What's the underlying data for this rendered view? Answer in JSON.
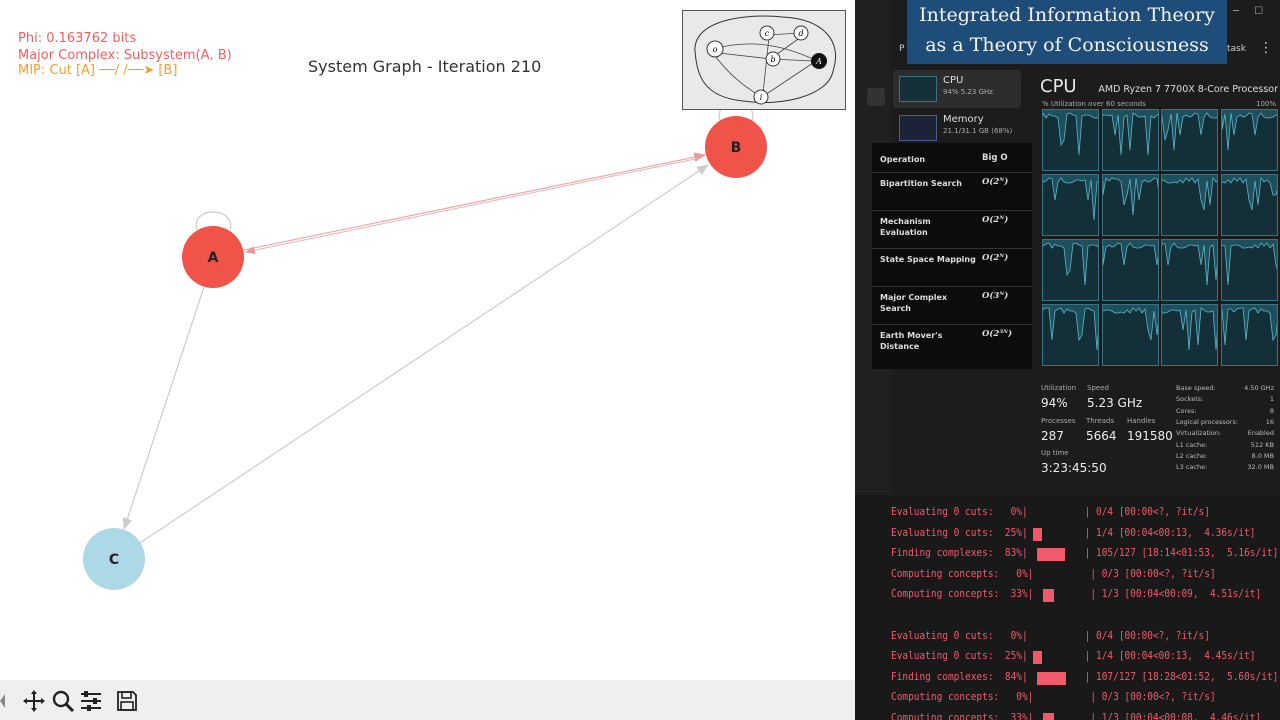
{
  "plot": {
    "phi": "Phi: 0.163762 bits",
    "major_complex": "Major Complex: Subsystem(A, B)",
    "mip": "MIP: Cut [A] ──/ /──➤ [B]",
    "title": "System Graph - Iteration 210",
    "nodes": [
      {
        "label": "A",
        "color": "#f05449"
      },
      {
        "label": "B",
        "color": "#f05449"
      },
      {
        "label": "C",
        "color": "#add8e6"
      }
    ],
    "colors": {
      "phi": "#f06060",
      "major_complex": "#f06060",
      "mip": "#f0a030",
      "edge_ab": "#e8a8a8",
      "edge": "#cccccc"
    }
  },
  "toolbar": {
    "icons": [
      "move-icon",
      "zoom-icon",
      "configure-icon",
      "save-icon"
    ]
  },
  "thumbnail": {
    "nodes": [
      "o",
      "c",
      "d",
      "b",
      "A",
      "i"
    ]
  },
  "banner": {
    "line1": "Integrated Information Theory",
    "line2": "as a Theory of Consciousness"
  },
  "taskmanager": {
    "nav": [
      {
        "label": "CPU",
        "sub": "94% 5.23 GHz"
      },
      {
        "label": "Memory",
        "sub": "21.1/31.1 GB (68%)"
      }
    ],
    "partial": {
      "left": "P",
      "right": "task"
    },
    "cpu_title": "CPU",
    "cpu_model": "AMD Ryzen 7 7700X 8-Core Processor",
    "util_label": "% Utilization over 60 seconds",
    "util_max": "100%",
    "utilization_label": "Utilization",
    "utilization": "94%",
    "speed_label": "Speed",
    "speed": "5.23 GHz",
    "processes_label": "Processes",
    "processes": "287",
    "threads_label": "Threads",
    "threads": "5664",
    "handles_label": "Handles",
    "handles": "191580",
    "uptime_label": "Up time",
    "uptime": "3:23:45:50",
    "specs": [
      {
        "k": "Base speed:",
        "v": "4.50 GHz"
      },
      {
        "k": "Sockets:",
        "v": "1"
      },
      {
        "k": "Cores:",
        "v": "8"
      },
      {
        "k": "Logical processors:",
        "v": "16"
      },
      {
        "k": "Virtualization:",
        "v": "Enabled"
      },
      {
        "k": "L1 cache:",
        "v": "512 KB"
      },
      {
        "k": "L2 cache:",
        "v": "8.0 MB"
      },
      {
        "k": "L3 cache:",
        "v": "32.0 MB"
      }
    ]
  },
  "complexity": {
    "head_op": "Operation",
    "head_cx": "Big O",
    "rows": [
      {
        "op": "Bipartition Search",
        "cx": "O(2ᴺ)"
      },
      {
        "op": "Mechanism Evaluation",
        "cx": "O(2ᴺ)"
      },
      {
        "op": "State Space Mapping",
        "cx": "O(2ᴺ)"
      },
      {
        "op": "Major Complex Search",
        "cx": "O(3ᴺ)"
      },
      {
        "op": "Earth Mover's Distance",
        "cx": "O(2³ᴺ)"
      }
    ]
  },
  "terminal": {
    "lines": [
      {
        "text": "Evaluating 0 cuts:   0%|          | 0/4 [00:00<?, ?it/s]",
        "pct": 0
      },
      {
        "text": "Evaluating 0 cuts:  25%|          | 1/4 [00:04<00:13,  4.36s/it]",
        "pct": 25
      },
      {
        "text": "Finding complexes:  83%|          | 105/127 [18:14<01:53,  5.16s/it]",
        "pct": 83
      },
      {
        "text": "Computing concepts:   0%|          | 0/3 [00:00<?, ?it/s]",
        "pct": 0
      },
      {
        "text": "Computing concepts:  33%|          | 1/3 [00:04<00:09,  4.51s/it]",
        "pct": 33
      },
      {
        "text": "",
        "pct": 0
      },
      {
        "text": "Evaluating 0 cuts:   0%|          | 0/4 [00:00<?, ?it/s]",
        "pct": 0
      },
      {
        "text": "Evaluating 0 cuts:  25%|          | 1/4 [00:04<00:13,  4.45s/it]",
        "pct": 25
      },
      {
        "text": "Finding complexes:  84%|          | 107/127 [18:28<01:52,  5.60s/it]",
        "pct": 84
      },
      {
        "text": "Computing concepts:   0%|          | 0/3 [00:00<?, ?it/s]",
        "pct": 0
      },
      {
        "text": "Computing concepts:  33%|          | 1/3 [00:04<00:08,  4.46s/it]",
        "pct": 33
      }
    ]
  }
}
